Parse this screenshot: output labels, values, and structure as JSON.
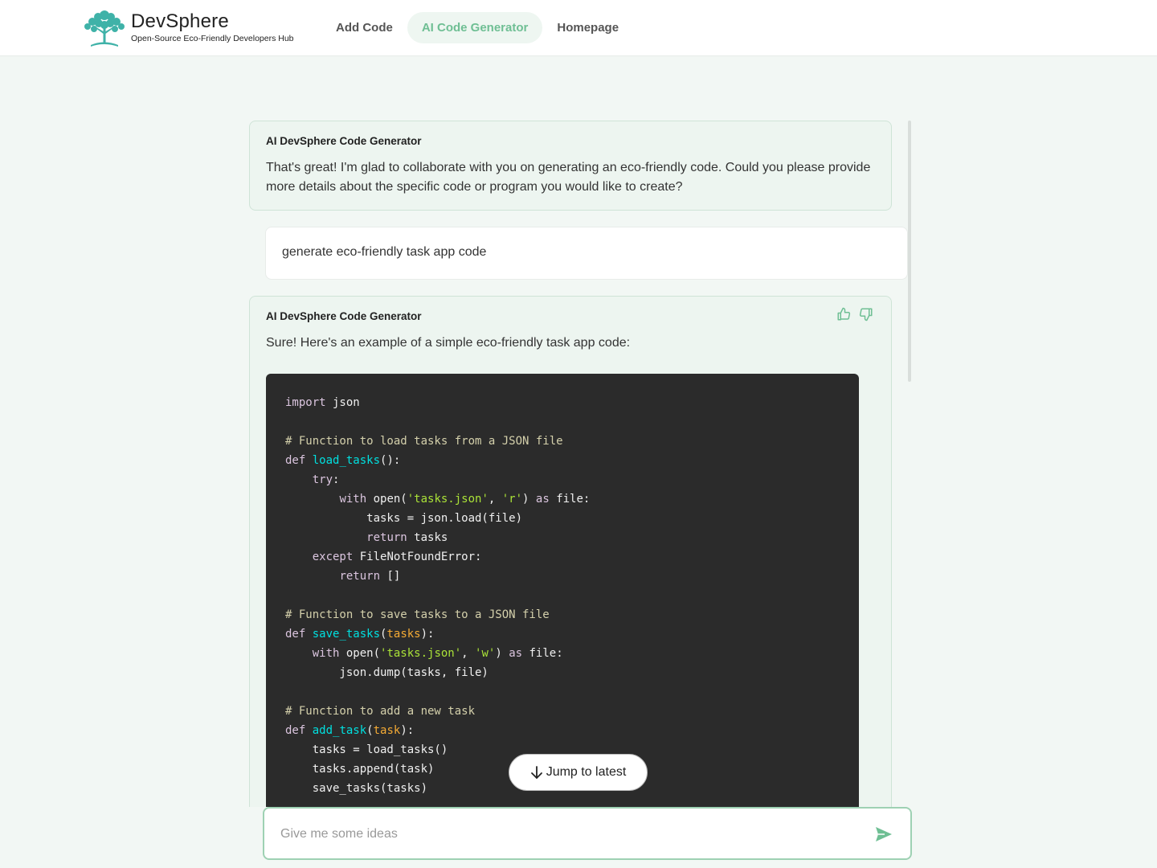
{
  "header": {
    "brand_name": "DevSphere",
    "brand_tagline": "Open-Source Eco-Friendly Developers Hub",
    "nav": [
      {
        "label": "Add Code",
        "active": false
      },
      {
        "label": "AI Code Generator",
        "active": true
      },
      {
        "label": "Homepage",
        "active": false
      }
    ]
  },
  "colors": {
    "accent": "#6fbf94",
    "background": "#f2f7f4",
    "ai_bubble": "#edf5f0",
    "code_bg": "#2b2b2b"
  },
  "chat": {
    "messages": [
      {
        "role": "ai",
        "sender": "AI DevSphere Code Generator",
        "text": "That's great! I'm glad to collaborate with you on generating an eco-friendly code. Could you please provide more details about the specific code or program you would like to create?"
      },
      {
        "role": "user",
        "text": "generate eco-friendly task app code"
      },
      {
        "role": "ai",
        "sender": "AI DevSphere Code Generator",
        "text": "Sure! Here's an example of a simple eco-friendly task app code:",
        "feedback_icons": [
          "thumbs-up-icon",
          "thumbs-down-icon"
        ]
      }
    ],
    "code_language": "python",
    "code_lines": [
      "import json",
      "",
      "# Function to load tasks from a JSON file",
      "def load_tasks():",
      "    try:",
      "        with open('tasks.json', 'r') as file:",
      "            tasks = json.load(file)",
      "            return tasks",
      "    except FileNotFoundError:",
      "        return []",
      "",
      "# Function to save tasks to a JSON file",
      "def save_tasks(tasks):",
      "    with open('tasks.json', 'w') as file:",
      "        json.dump(tasks, file)",
      "",
      "# Function to add a new task",
      "def add_task(task):",
      "    tasks = load_tasks()",
      "    tasks.append(task)",
      "    save_tasks(tasks)",
      ""
    ]
  },
  "jump_button": {
    "label": "Jump to latest",
    "icon": "arrow-down-icon"
  },
  "composer": {
    "placeholder": "Give me some ideas",
    "value": "",
    "send_icon": "send-icon"
  }
}
